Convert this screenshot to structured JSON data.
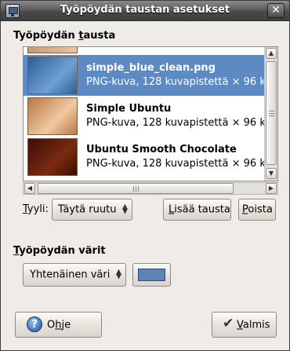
{
  "window": {
    "title": "Työpöydän taustan asetukset",
    "close_glyph": "✕"
  },
  "background_section": {
    "label_before": "Työpöydän ",
    "label_mnemonic": "t",
    "label_after": "austa",
    "items": [
      {
        "name": "simple_blue_clean.png",
        "meta": "PNG-kuva, 128 kuvapistettä × 96 ku",
        "thumb_colors": [
          "#2a5f9a",
          "#6fa0d2"
        ],
        "selected": true
      },
      {
        "name": "Simple Ubuntu",
        "meta": "PNG-kuva, 128 kuvapistettä × 96 ku",
        "thumb_colors": [
          "#b87844",
          "#f0c9a0"
        ],
        "selected": false
      },
      {
        "name": "Ubuntu Smooth Chocolate",
        "meta": "PNG-kuva, 128 kuvapistettä × 96 ku",
        "thumb_colors": [
          "#3a0f05",
          "#7a2a10"
        ],
        "selected": false
      }
    ],
    "style_label_mnemonic": "T",
    "style_label_rest": "yyli:",
    "style_value": "Täytä ruutu",
    "add_button_mnemonic": "L",
    "add_button_rest": "isää tausta",
    "remove_button_mnemonic": "P",
    "remove_button_rest": "oista"
  },
  "colors_section": {
    "label_mnemonic": "T",
    "label_rest": "yöpöydän värit",
    "fill_type_value": "Yhtenäinen väri",
    "color_value": "#5f83b5"
  },
  "footer": {
    "help_mnemonic": "h",
    "help_before": "O",
    "help_after": "je",
    "ok_mnemonic": "V",
    "ok_rest": "almis"
  },
  "icons": {
    "help": "help-icon",
    "ok": "checkmark-icon",
    "window": "display-preferences-icon"
  },
  "colors": {
    "selection": "#5e8ac3",
    "window_bg": "#efebe7",
    "titlebar": "#4a4a4a"
  }
}
